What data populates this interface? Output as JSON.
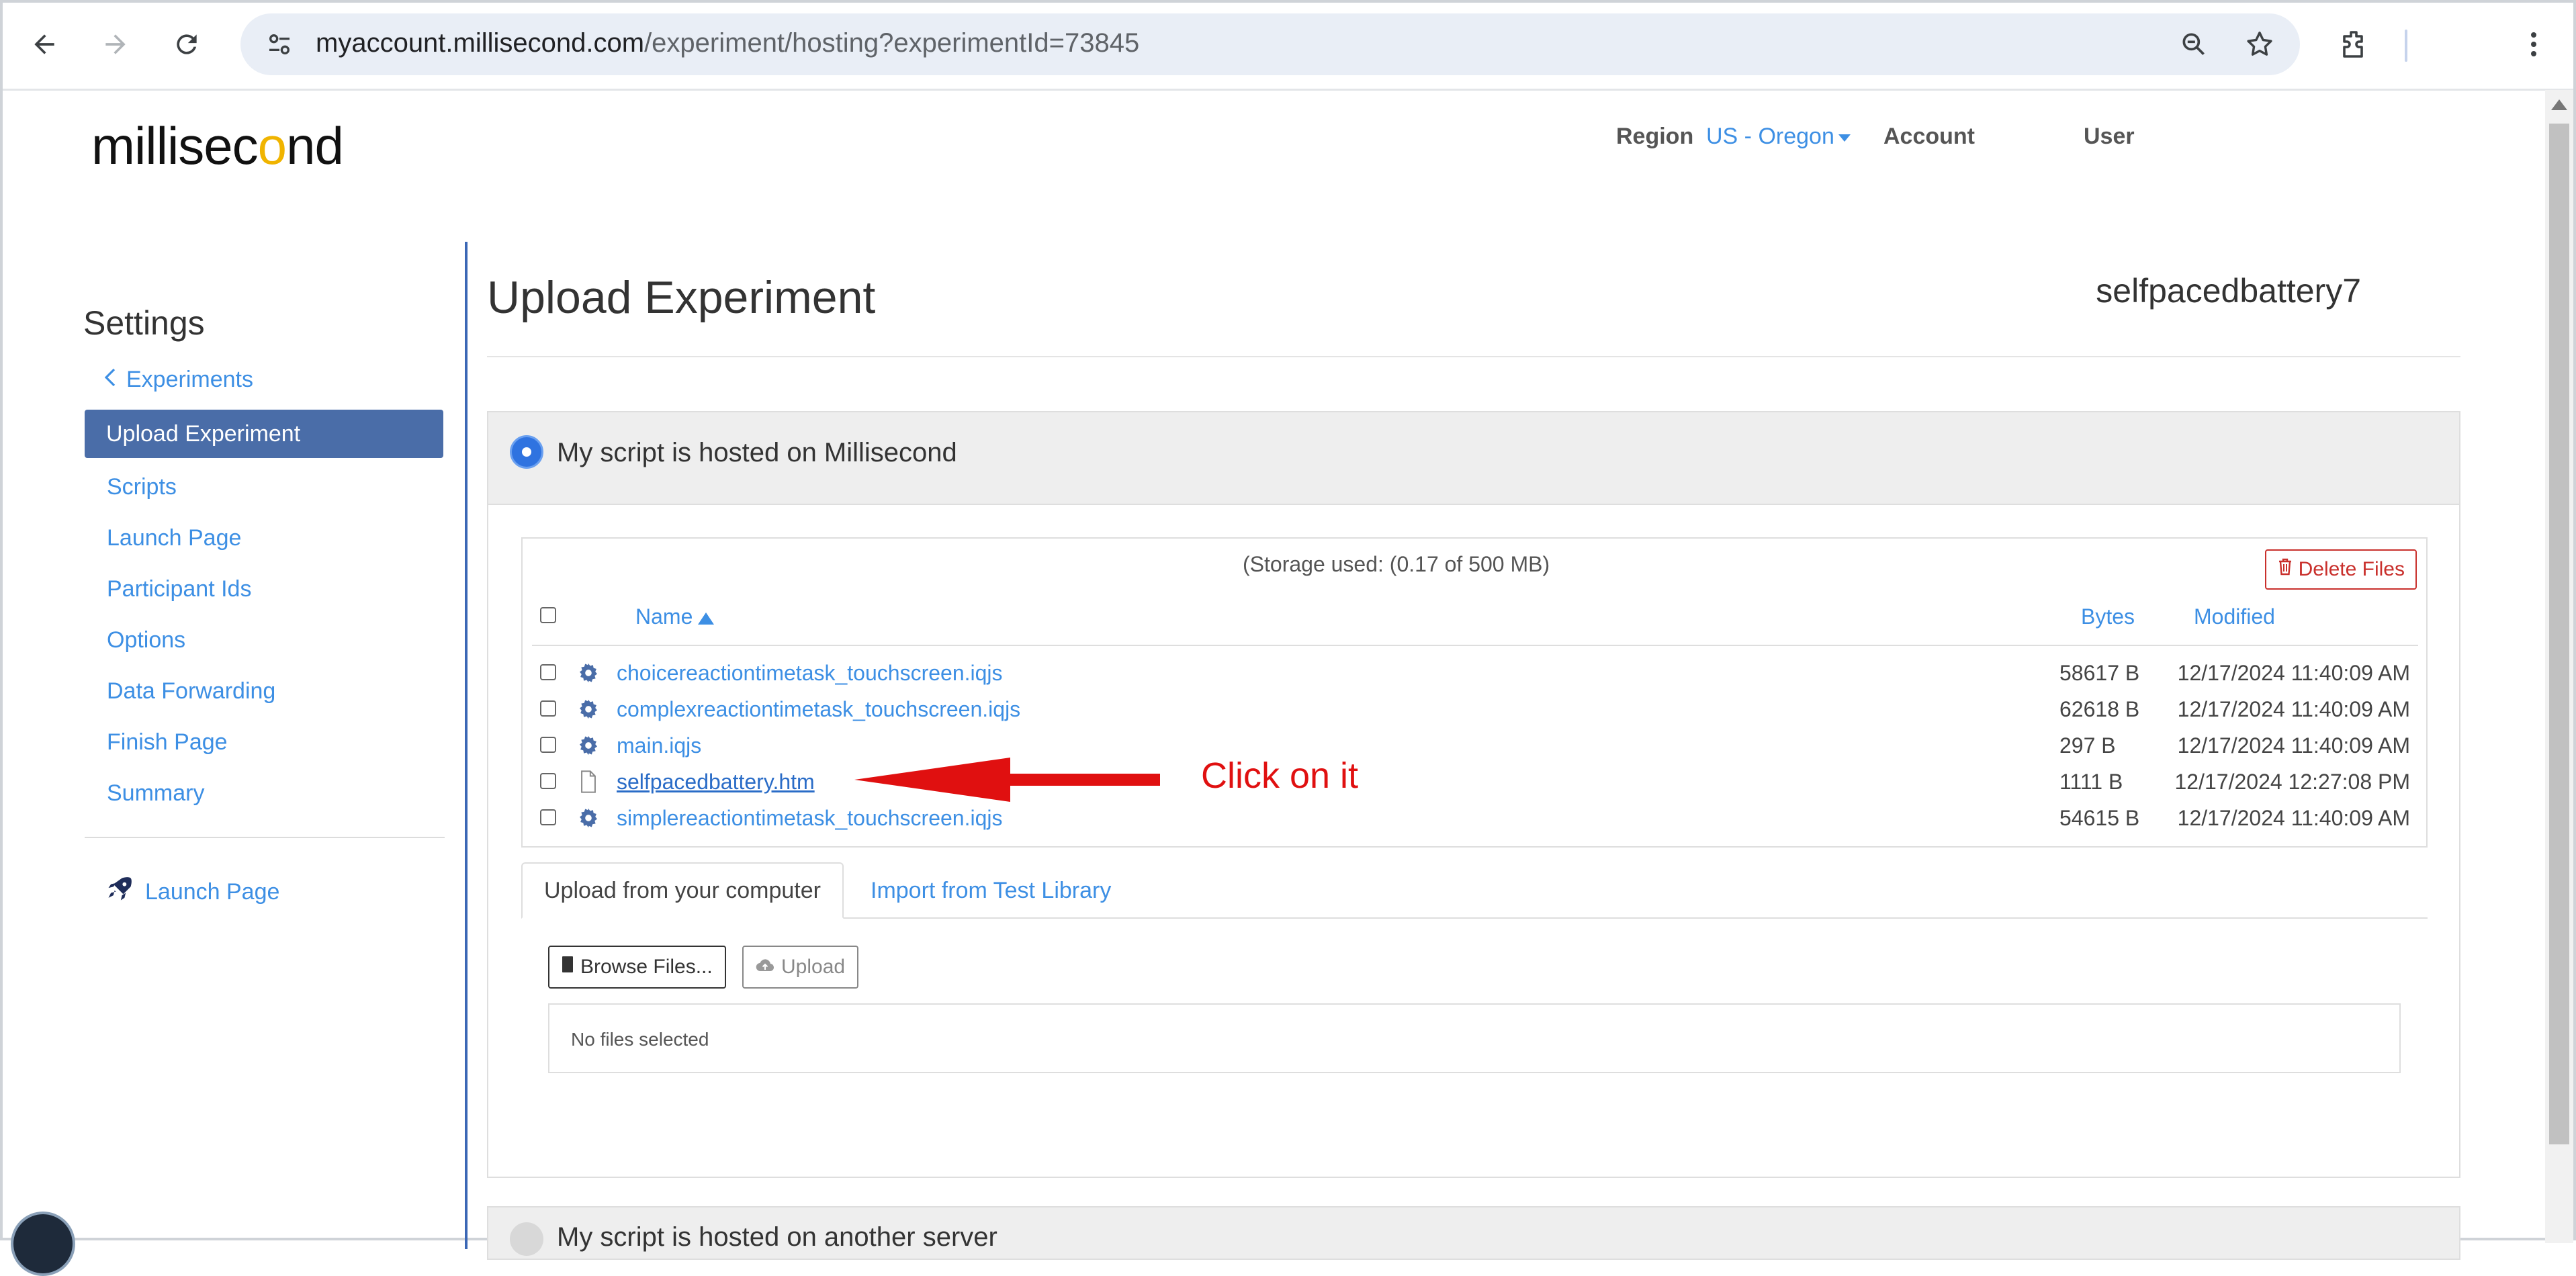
{
  "browser": {
    "url_host": "myaccount.millisecond.com",
    "url_path": "/experiment/hosting?experimentId=73845"
  },
  "header": {
    "logo_text_pre": "millisec",
    "logo_text_o": "o",
    "logo_text_post": "nd",
    "region_label": "Region",
    "region_value": "US - Oregon",
    "account_label": "Account",
    "user_label": "User"
  },
  "sidebar": {
    "title": "Settings",
    "back_link": "Experiments",
    "active_item": "Upload Experiment",
    "items": [
      "Scripts",
      "Launch Page",
      "Participant Ids",
      "Options",
      "Data Forwarding",
      "Finish Page",
      "Summary"
    ],
    "launch_link": "Launch Page"
  },
  "main": {
    "title": "Upload Experiment",
    "experiment_name": "selfpacedbattery7",
    "hosted_option": "My script is hosted on Millisecond",
    "other_option": "My script is hosted on another server",
    "storage_text": "(Storage used: (0.17 of 500 MB)",
    "delete_button": "Delete Files",
    "columns": {
      "name": "Name",
      "bytes": "Bytes",
      "modified": "Modified"
    },
    "files": [
      {
        "name": "choicereactiontimetask_touchscreen.iqjs",
        "bytes": "58617 B",
        "modified": "12/17/2024 11:40:09 AM",
        "icon": "gear-icon"
      },
      {
        "name": "complexreactiontimetask_touchscreen.iqjs",
        "bytes": "62618 B",
        "modified": "12/17/2024 11:40:09 AM",
        "icon": "gear-icon"
      },
      {
        "name": "main.iqjs",
        "bytes": "297 B",
        "modified": "12/17/2024 11:40:09 AM",
        "icon": "gear-icon"
      },
      {
        "name": "selfpacedbattery.htm",
        "bytes": "1111 B",
        "modified": "12/17/2024 12:27:08 PM",
        "icon": "file-icon"
      },
      {
        "name": "simplereactiontimetask_touchscreen.iqjs",
        "bytes": "54615 B",
        "modified": "12/17/2024 11:40:09 AM",
        "icon": "gear-icon"
      }
    ],
    "annotation": "Click on it",
    "tabs": [
      "Upload from your computer",
      "Import from Test Library"
    ],
    "browse_button": "Browse Files...",
    "upload_button": "Upload",
    "no_files_text": "No files selected"
  },
  "colors": {
    "accent": "#3d8fe4",
    "active_nav": "#4a6da8",
    "danger": "#c9302c",
    "annotation": "#e01010"
  }
}
